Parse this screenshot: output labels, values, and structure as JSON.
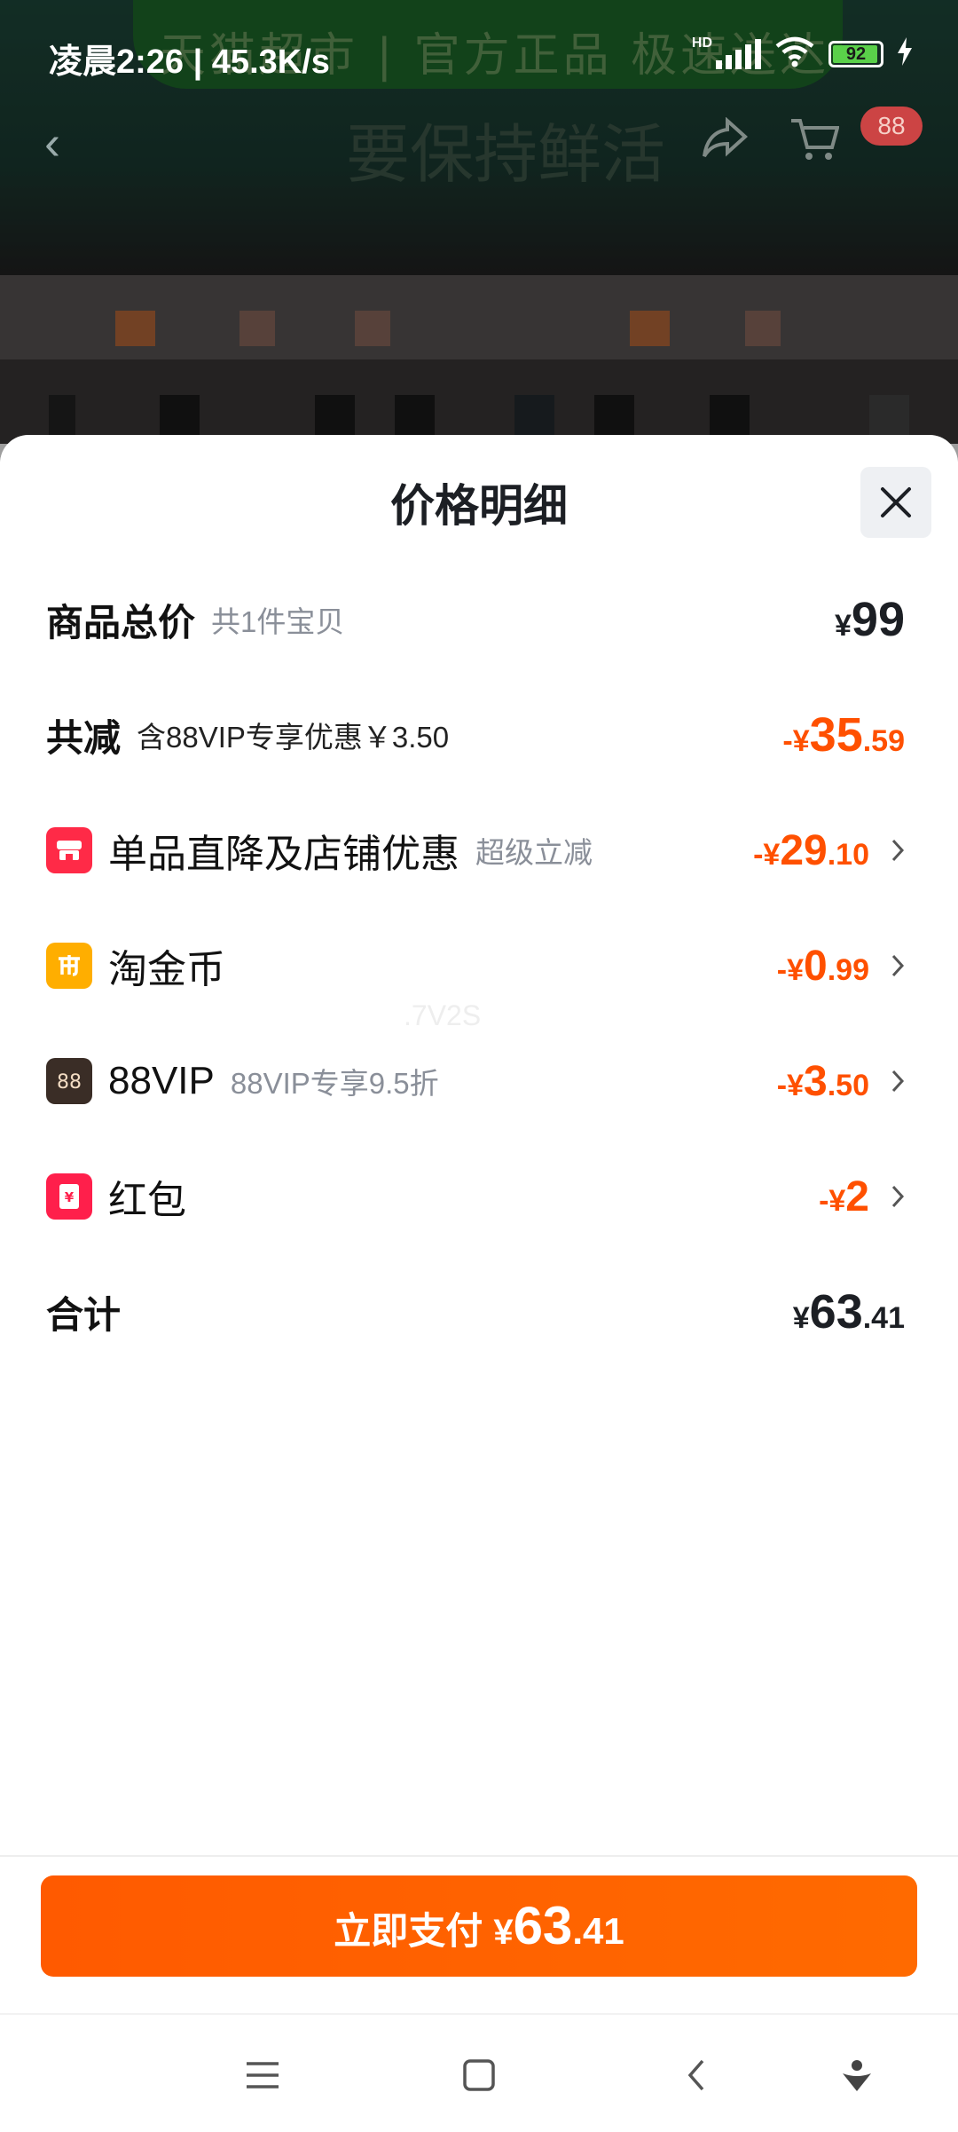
{
  "status_bar": {
    "time_speed": "凌晨2:26 | 45.3K/s",
    "battery": "92",
    "network_badge": "HD"
  },
  "background": {
    "banner_text": "天猫超市 | 官方正品 极速送达",
    "slogan": "要保持鲜活",
    "cart_badge": "88"
  },
  "sheet": {
    "title": "价格明细",
    "total": {
      "label": "商品总价",
      "sub": "共1件宝贝",
      "yen": "¥",
      "int": "99",
      "dec": ""
    },
    "discount": {
      "label": "共减",
      "sub": "含88VIP专享优惠￥3.50",
      "prefix": "-¥",
      "int": "35",
      "dec": ".59"
    },
    "items": [
      {
        "label": "单品直降及店铺优惠",
        "sub": "超级立减",
        "prefix": "-¥",
        "int": "29",
        "dec": ".10",
        "icon": "shop-icon",
        "icon_color": "#ff2a47"
      },
      {
        "label": "淘金币",
        "sub": "",
        "prefix": "-¥",
        "int": "0",
        "dec": ".99",
        "icon": "gold-coin-icon",
        "icon_color": "#ffae00"
      },
      {
        "label": "88VIP",
        "sub": "88VIP专享9.5折",
        "prefix": "-¥",
        "int": "3",
        "dec": ".50",
        "icon": "vip-88-icon",
        "icon_color": "#3a2d26"
      },
      {
        "label": "红包",
        "sub": "",
        "prefix": "-¥",
        "int": "2",
        "dec": "",
        "icon": "red-packet-icon",
        "icon_color": "#ff1f4b"
      }
    ],
    "sum": {
      "label": "合计",
      "yen": "¥",
      "int": "63",
      "dec": ".41"
    },
    "watermark": ".7V2S"
  },
  "pay_button": {
    "label": "立即支付",
    "yen": "¥",
    "int": "63",
    "dec": ".41"
  },
  "colors": {
    "accent": "#ff5000",
    "text_dark": "#1c1f24",
    "text_muted": "#8a8f99"
  }
}
